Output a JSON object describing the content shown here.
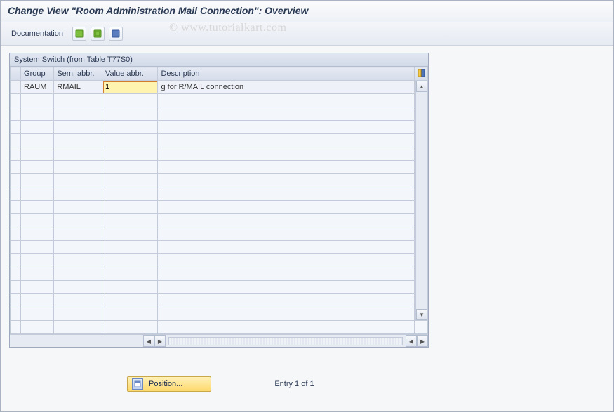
{
  "title": "Change View \"Room Administration Mail Connection\": Overview",
  "watermark": "© www.tutorialkart.com",
  "toolbar": {
    "documentation": "Documentation"
  },
  "panel": {
    "title": "System Switch (from Table T77S0)"
  },
  "columns": {
    "group": "Group",
    "sem_abbr": "Sem. abbr.",
    "value_abbr": "Value abbr.",
    "description": "Description"
  },
  "row": {
    "group": "RAUM",
    "sem_abbr": "RMAIL",
    "value_abbr": "1",
    "description": "g for R/MAIL connection"
  },
  "footer": {
    "position_btn": "Position...",
    "entry_text": "Entry 1 of 1"
  }
}
